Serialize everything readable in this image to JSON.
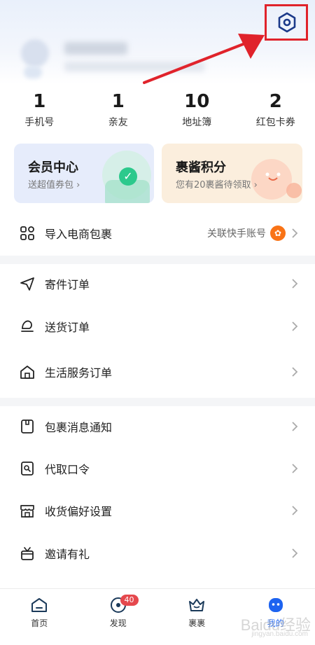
{
  "stats": [
    {
      "value": "1",
      "label": "手机号"
    },
    {
      "value": "1",
      "label": "亲友"
    },
    {
      "value": "10",
      "label": "地址簿"
    },
    {
      "value": "2",
      "label": "红包卡券"
    }
  ],
  "cards": {
    "member": {
      "title": "会员中心",
      "subtitle": "送超值券包 ›"
    },
    "points": {
      "title": "裹酱积分",
      "subtitle": "您有20裹酱待领取 ›"
    }
  },
  "import_row": {
    "label": "导入电商包裹",
    "right_text": "关联快手账号",
    "icon": "package-import-icon"
  },
  "orders": [
    {
      "label": "寄件订单",
      "icon": "send-icon"
    },
    {
      "label": "送货订单",
      "icon": "delivery-icon"
    },
    {
      "label": "生活服务订单",
      "icon": "home-icon"
    }
  ],
  "settings_list": [
    {
      "label": "包裹消息通知",
      "icon": "notification-icon"
    },
    {
      "label": "代取口令",
      "icon": "pickup-code-icon"
    },
    {
      "label": "收货偏好设置",
      "icon": "store-icon"
    },
    {
      "label": "邀请有礼",
      "icon": "gift-icon"
    }
  ],
  "tabbar": [
    {
      "label": "首页",
      "icon": "home-tab-icon"
    },
    {
      "label": "发现",
      "icon": "discover-icon",
      "badge": "40"
    },
    {
      "label": "裹裹",
      "icon": "guoguo-icon"
    },
    {
      "label": "我的",
      "icon": "profile-icon"
    }
  ],
  "watermark": {
    "main": "Baidu经验",
    "sub": "jingyan.baidu.com"
  },
  "colors": {
    "accent": "#1d63f0",
    "highlight_box": "#e0232b",
    "badge": "#e5484d",
    "settings_icon": "#1b3a8a"
  }
}
